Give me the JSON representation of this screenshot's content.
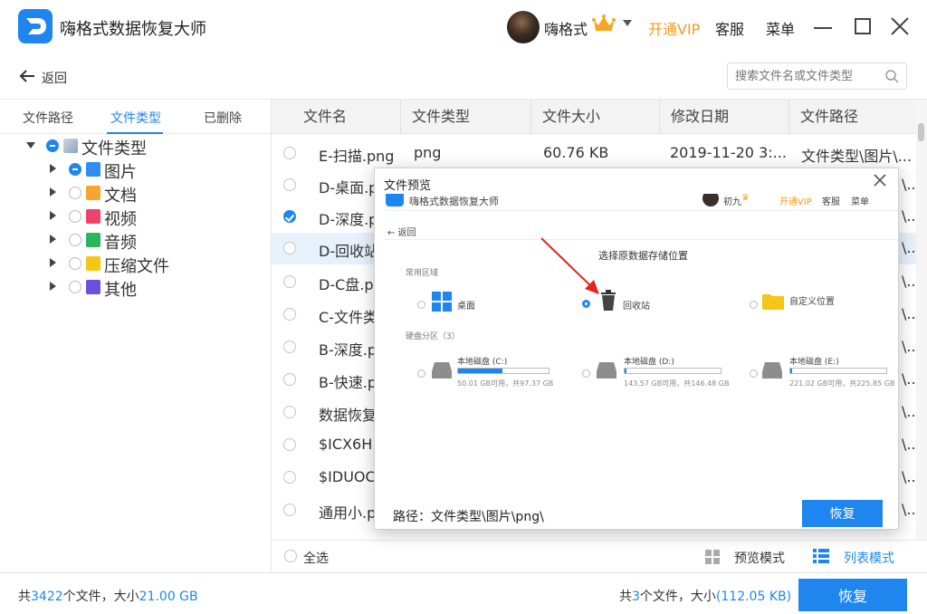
{
  "app": {
    "title": "嗨格式数据恢复大师",
    "user_name": "嗨格式",
    "vip_label": "开通VIP",
    "service_label": "客服",
    "menu_label": "菜单"
  },
  "toolbar": {
    "back_label": "返回",
    "search_placeholder": "搜索文件名或文件类型"
  },
  "left_tabs": [
    "文件路径",
    "文件类型",
    "已删除"
  ],
  "tree": {
    "root_label": "文件类型",
    "items": [
      "图片",
      "文档",
      "视频",
      "音频",
      "压缩文件",
      "其他"
    ]
  },
  "columns": [
    "文件名",
    "文件类型",
    "文件大小",
    "修改日期",
    "文件路径"
  ],
  "rows": [
    {
      "name": "E-扫描.png",
      "type": "png",
      "size": "60.76 KB",
      "date": "2019-11-20 3:...",
      "path": "文件类型\\图片\\..."
    },
    {
      "name": "D-桌面.p",
      "type": "",
      "size": "",
      "date": "",
      "path": "\\..."
    },
    {
      "name": "D-深度.p",
      "type": "",
      "size": "",
      "date": "",
      "path": "\\..."
    },
    {
      "name": "D-回收站",
      "type": "",
      "size": "",
      "date": "",
      "path": "\\..."
    },
    {
      "name": "D-C盘.p",
      "type": "",
      "size": "",
      "date": "",
      "path": "\\..."
    },
    {
      "name": "C-文件类",
      "type": "",
      "size": "",
      "date": "",
      "path": "\\..."
    },
    {
      "name": "B-深度.p",
      "type": "",
      "size": "",
      "date": "",
      "path": "\\..."
    },
    {
      "name": "B-快速.p",
      "type": "",
      "size": "",
      "date": "",
      "path": "\\..."
    },
    {
      "name": "数据恢复",
      "type": "",
      "size": "",
      "date": "",
      "path": "\\..."
    },
    {
      "name": "$ICX6H",
      "type": "",
      "size": "",
      "date": "",
      "path": "\\..."
    },
    {
      "name": "$IDUOC",
      "type": "",
      "size": "",
      "date": "",
      "path": "\\..."
    },
    {
      "name": "通用小.p",
      "type": "",
      "size": "",
      "date": "",
      "path": "\\..."
    }
  ],
  "list_footer": {
    "select_all_label": "全选",
    "preview_mode_label": "预览模式",
    "list_mode_label": "列表模式"
  },
  "status": {
    "total_prefix": "共",
    "total_count": "3422",
    "total_mid": "个文件，大小",
    "total_size": "21.00 GB",
    "selected_prefix": "共",
    "selected_count": "3",
    "selected_mid": "个文件，大小",
    "selected_size": "(112.05 KB)",
    "recover_label": "恢复"
  },
  "dialog": {
    "title": "文件预览",
    "path_label": "路径：文件类型\\图片\\png\\",
    "recover_label": "恢复",
    "preview": {
      "app_title": "嗨格式数据恢复大师",
      "user_name": "初九",
      "vip_label": "开通VIP",
      "service_label": "客服",
      "menu_label": "菜单",
      "back_label": "返回",
      "heading": "选择原数据存储位置",
      "common_section": "常用区域",
      "locations": [
        "桌面",
        "回收站",
        "自定义位置"
      ],
      "partition_section": "硬盘分区（3）",
      "drives": [
        {
          "label": "本地磁盘 (C:)",
          "detail": "50.01 GB可用，共97.37 GB",
          "used": 0.49
        },
        {
          "label": "本地磁盘 (D:)",
          "detail": "143.57 GB可用，共146.48 GB",
          "used": 0.02
        },
        {
          "label": "本地磁盘 (E:)",
          "detail": "221.02 GB可用，共225.85 GB",
          "used": 0.02
        }
      ]
    }
  },
  "colors": {
    "accent": "#1f86f0",
    "vip": "#f39a1b",
    "selected_row": "#e6f1fc"
  }
}
